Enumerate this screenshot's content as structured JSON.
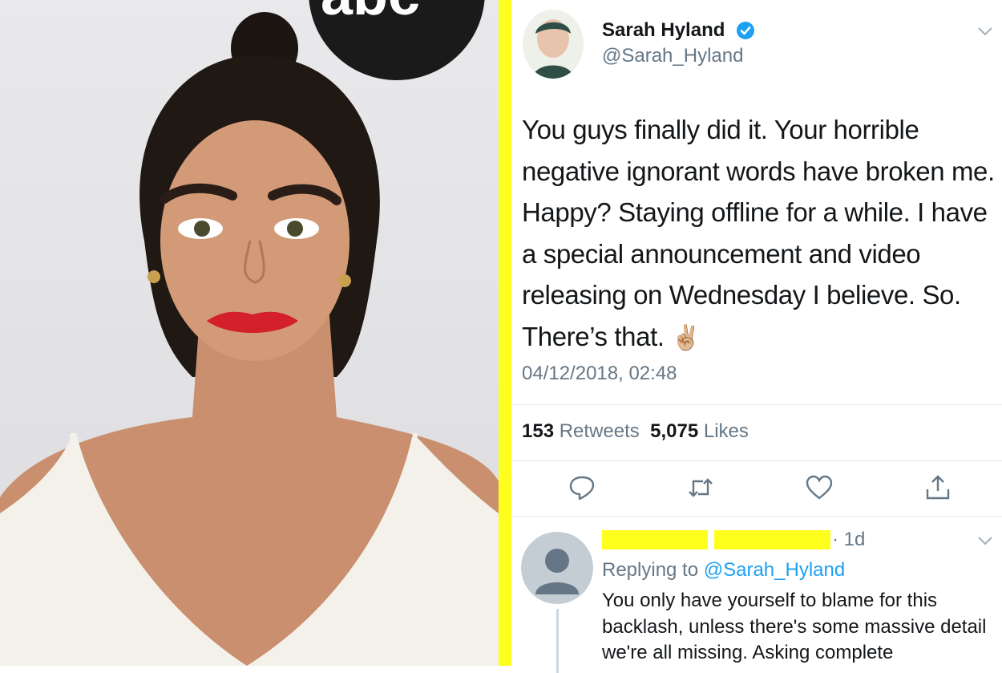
{
  "photo": {
    "description_icon": "person-photo",
    "backdrop_logo_text": "abc"
  },
  "tweet": {
    "author_name": "Sarah Hyland",
    "handle": "@Sarah_Hyland",
    "verified_icon": "verified-badge-icon",
    "text": "You guys finally did it. Your horrible negative ignorant words have broken me. Happy? Staying offline for a while. I have a special announcement and video releasing on Wednesday I believe. So. There’s that.",
    "emoji": "✌🏼",
    "timestamp": "04/12/2018, 02:48",
    "retweets_count": "153",
    "retweets_label": "Retweets",
    "likes_count": "5,075",
    "likes_label": "Likes",
    "actions": [
      "reply-icon",
      "retweet-icon",
      "like-icon",
      "share-icon"
    ]
  },
  "reply": {
    "time": "· 1d",
    "replying_prefix": "Replying to",
    "replying_mention": "@Sarah_Hyland",
    "text": "You only have yourself to blame for this backlash, unless there's some massive detail we're all missing. Asking complete"
  },
  "colors": {
    "divider": "#ffff1e",
    "accent": "#1da1f2",
    "muted": "#657786"
  }
}
